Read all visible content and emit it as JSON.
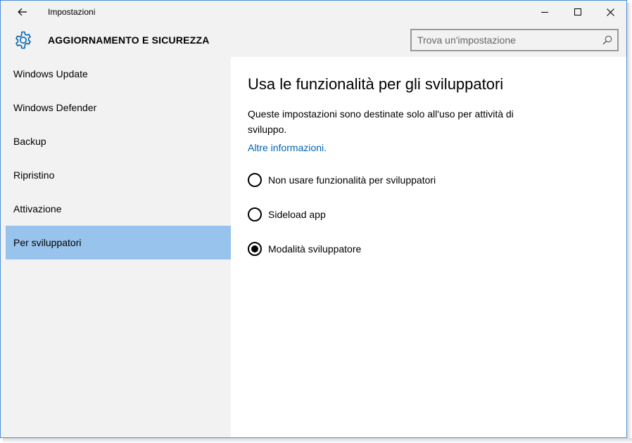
{
  "window": {
    "title": "Impostazioni"
  },
  "header": {
    "section_title": "AGGIORNAMENTO E SICUREZZA",
    "search_placeholder": "Trova un'impostazione"
  },
  "sidebar": {
    "items": [
      {
        "label": "Windows Update",
        "selected": false
      },
      {
        "label": "Windows Defender",
        "selected": false
      },
      {
        "label": "Backup",
        "selected": false
      },
      {
        "label": "Ripristino",
        "selected": false
      },
      {
        "label": "Attivazione",
        "selected": false
      },
      {
        "label": "Per sviluppatori",
        "selected": true
      }
    ]
  },
  "main": {
    "title": "Usa le funzionalità per gli sviluppatori",
    "description": "Queste impostazioni sono destinate solo all'uso per attività di sviluppo.",
    "more_info_link": "Altre informazioni.",
    "options": [
      {
        "label": "Non usare funzionalità per sviluppatori",
        "checked": false
      },
      {
        "label": "Sideload app",
        "checked": false
      },
      {
        "label": "Modalità sviluppatore",
        "checked": true
      }
    ]
  },
  "colors": {
    "accent": "#0063b1",
    "selection": "#97c3ec",
    "chrome": "#f2f2f2",
    "window_border": "#4a8fd6"
  },
  "icons": [
    "back-arrow-icon",
    "minimize-icon",
    "maximize-icon",
    "close-icon",
    "gear-icon",
    "search-icon"
  ]
}
